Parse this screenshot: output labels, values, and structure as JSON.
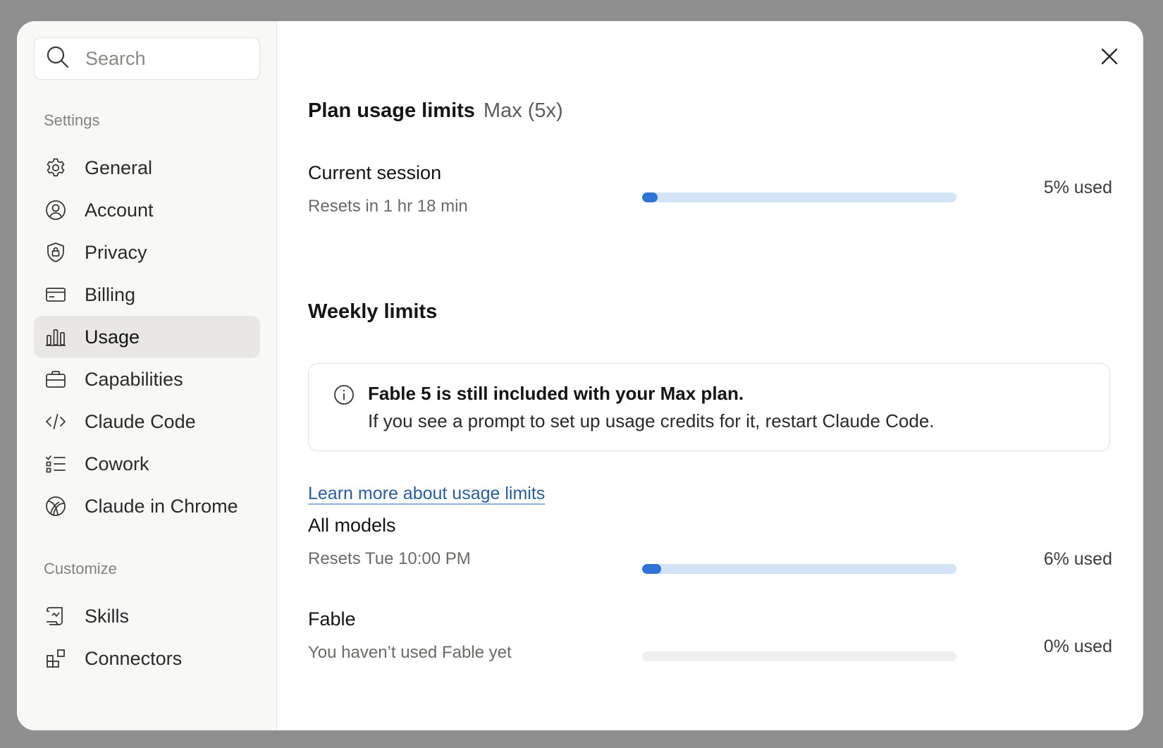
{
  "search": {
    "placeholder": "Search"
  },
  "sidebar": {
    "settings_label": "Settings",
    "items": [
      {
        "label": "General",
        "icon": "gear-icon"
      },
      {
        "label": "Account",
        "icon": "user-circle-icon"
      },
      {
        "label": "Privacy",
        "icon": "shield-lock-icon"
      },
      {
        "label": "Billing",
        "icon": "credit-card-icon"
      },
      {
        "label": "Usage",
        "icon": "bar-chart-icon",
        "active": true
      },
      {
        "label": "Capabilities",
        "icon": "briefcase-icon"
      },
      {
        "label": "Claude Code",
        "icon": "code-icon"
      },
      {
        "label": "Cowork",
        "icon": "checklist-icon"
      },
      {
        "label": "Claude in Chrome",
        "icon": "globe-icon"
      }
    ],
    "customize_label": "Customize",
    "customize_items": [
      {
        "label": "Skills",
        "icon": "scroll-icon"
      },
      {
        "label": "Connectors",
        "icon": "blocks-icon"
      }
    ]
  },
  "main": {
    "plan_title": "Plan usage limits",
    "plan_name": "Max (5x)",
    "current_session": {
      "title": "Current session",
      "subtitle": "Resets in 1 hr 18 min",
      "percent_text": "5% used",
      "fill_fraction": 0.05
    },
    "weekly_title": "Weekly limits",
    "notice": {
      "title": "Fable 5 is still included with your Max plan.",
      "body": "If you see a prompt to set up usage credits for it, restart Claude Code."
    },
    "learn_more": "Learn more about usage limits",
    "all_models": {
      "title": "All models",
      "subtitle": "Resets Tue 10:00 PM",
      "percent_text": "6% used",
      "fill_fraction": 0.06
    },
    "fable": {
      "title": "Fable",
      "subtitle": "You haven’t used Fable yet",
      "percent_text": "0% used",
      "fill_fraction": 0
    }
  },
  "colors": {
    "accent": "#2e73d6",
    "bar_track": "#d5e3f7",
    "sidebar_bg": "#f8f8f6",
    "active_item_bg": "#e8e7e3",
    "link": "#2a5d9e"
  }
}
